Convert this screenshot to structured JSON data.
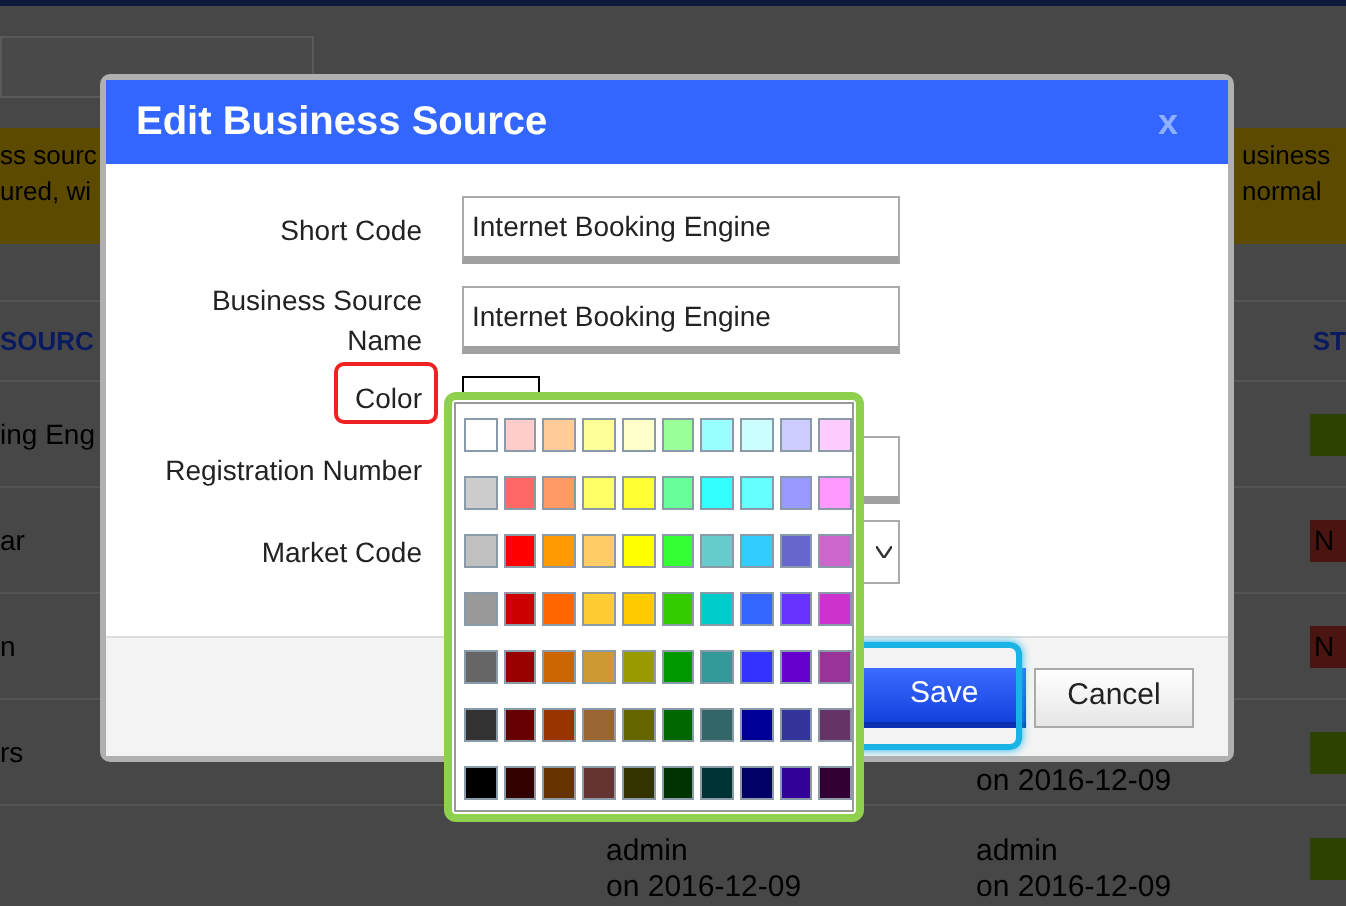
{
  "background": {
    "notice_left": [
      "ss sourc",
      "ured, wi"
    ],
    "notice_right": [
      "usiness",
      "normal"
    ],
    "table": {
      "columns": [
        "SOURC",
        "ST"
      ],
      "rows": [
        {
          "source": "ing Eng",
          "status": {
            "color": "#2c4400"
          }
        },
        {
          "source": "ar",
          "status": {
            "color": "#4a1410",
            "label": "N"
          }
        },
        {
          "source": "n",
          "status": {
            "color": "#4a1410",
            "label": "N"
          }
        },
        {
          "source": "rs",
          "col_3": [
            "on 2016-12-09"
          ],
          "status": {
            "color": "#2c4400"
          }
        },
        {
          "col_2": [
            "admin",
            "on 2016-12-09"
          ],
          "col_3": [
            "admin",
            "on 2016-12-09"
          ],
          "status": {
            "color": "#2c4400"
          }
        }
      ]
    }
  },
  "dialog": {
    "title": "Edit Business Source",
    "close": "x",
    "fields": [
      {
        "kind": "text",
        "label": "Short Code",
        "highlighted": false,
        "value": "Internet Booking Engine"
      },
      {
        "kind": "text",
        "label": "Business Source Name",
        "highlighted": false,
        "value": "Internet Booking Engine"
      },
      {
        "kind": "color",
        "label": "Color",
        "highlighted": true,
        "color": "#ffffff"
      },
      {
        "kind": "text",
        "label": "Registration Number",
        "highlighted": false
      },
      {
        "kind": "select",
        "label": "Market Code",
        "highlighted": false
      }
    ],
    "buttons": [
      {
        "label": "Save",
        "kind": "primary",
        "highlighted": true
      },
      {
        "label": "Cancel",
        "kind": "secondary",
        "highlighted": false
      }
    ]
  },
  "color_picker": {
    "highlighted": true,
    "rows": [
      {
        "swatches": [
          {
            "color": "#ffffff"
          },
          {
            "color": "#ffcccc"
          },
          {
            "color": "#ffcc99"
          },
          {
            "color": "#ffff99"
          },
          {
            "color": "#ffffcc"
          },
          {
            "color": "#99ff99"
          },
          {
            "color": "#99ffff"
          },
          {
            "color": "#ccffff"
          },
          {
            "color": "#ccccff"
          },
          {
            "color": "#ffccff"
          }
        ]
      },
      {
        "swatches": [
          {
            "color": "#cccccc"
          },
          {
            "color": "#ff6666"
          },
          {
            "color": "#ff9966"
          },
          {
            "color": "#ffff66"
          },
          {
            "color": "#ffff33"
          },
          {
            "color": "#66ff99"
          },
          {
            "color": "#33ffff"
          },
          {
            "color": "#66ffff"
          },
          {
            "color": "#9999ff"
          },
          {
            "color": "#ff99ff"
          }
        ]
      },
      {
        "swatches": [
          {
            "color": "#c0c0c0"
          },
          {
            "color": "#ff0000"
          },
          {
            "color": "#ff9900"
          },
          {
            "color": "#ffcc66"
          },
          {
            "color": "#ffff00"
          },
          {
            "color": "#33ff33"
          },
          {
            "color": "#66cccc"
          },
          {
            "color": "#33ccff"
          },
          {
            "color": "#6666cc"
          },
          {
            "color": "#cc66cc"
          }
        ]
      },
      {
        "swatches": [
          {
            "color": "#999999"
          },
          {
            "color": "#cc0000"
          },
          {
            "color": "#ff6600"
          },
          {
            "color": "#ffcc33"
          },
          {
            "color": "#ffcc00"
          },
          {
            "color": "#33cc00"
          },
          {
            "color": "#00cccc"
          },
          {
            "color": "#3366ff"
          },
          {
            "color": "#6633ff"
          },
          {
            "color": "#cc33cc"
          }
        ]
      },
      {
        "swatches": [
          {
            "color": "#666666"
          },
          {
            "color": "#990000"
          },
          {
            "color": "#cc6600"
          },
          {
            "color": "#cc9933"
          },
          {
            "color": "#999900"
          },
          {
            "color": "#009900"
          },
          {
            "color": "#339999"
          },
          {
            "color": "#3333ff"
          },
          {
            "color": "#6600cc"
          },
          {
            "color": "#993399"
          }
        ]
      },
      {
        "swatches": [
          {
            "color": "#333333"
          },
          {
            "color": "#660000"
          },
          {
            "color": "#993300"
          },
          {
            "color": "#996633"
          },
          {
            "color": "#666600"
          },
          {
            "color": "#006600"
          },
          {
            "color": "#336666"
          },
          {
            "color": "#000099"
          },
          {
            "color": "#333399"
          },
          {
            "color": "#663366"
          }
        ]
      },
      {
        "swatches": [
          {
            "color": "#000000"
          },
          {
            "color": "#330000"
          },
          {
            "color": "#663300"
          },
          {
            "color": "#663333"
          },
          {
            "color": "#333300"
          },
          {
            "color": "#003300"
          },
          {
            "color": "#003333"
          },
          {
            "color": "#000066"
          },
          {
            "color": "#330099"
          },
          {
            "color": "#330033"
          }
        ]
      }
    ]
  }
}
